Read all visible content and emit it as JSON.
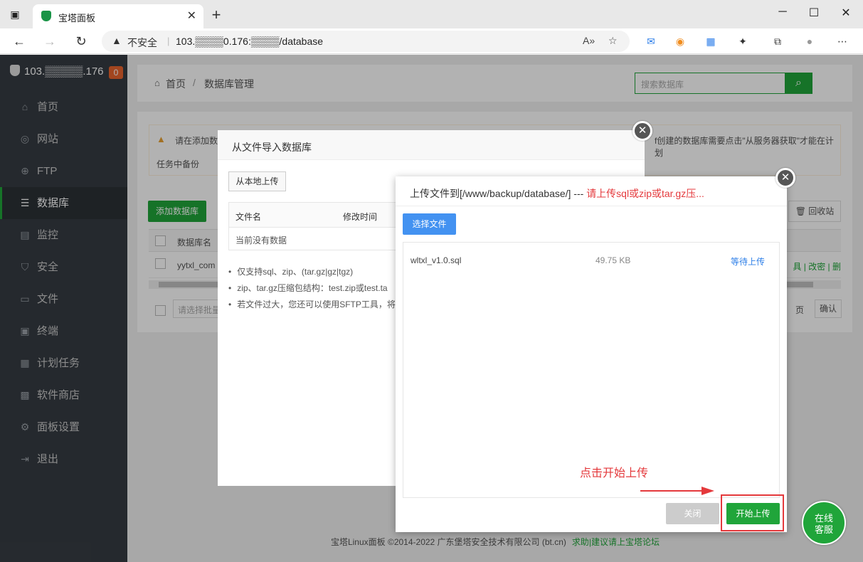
{
  "browser": {
    "tab_title": "宝塔面板",
    "insecure_label": "不安全",
    "url": "103.▒▒▒▒0.176:▒▒▒▒/database"
  },
  "sidebar": {
    "server": "103.▒▒▒▒▒.176",
    "badge": "0",
    "items": [
      {
        "label": "首页",
        "icon": "home-icon"
      },
      {
        "label": "网站",
        "icon": "globe-icon"
      },
      {
        "label": "FTP",
        "icon": "ftp-icon"
      },
      {
        "label": "数据库",
        "icon": "database-icon"
      },
      {
        "label": "监控",
        "icon": "monitor-icon"
      },
      {
        "label": "安全",
        "icon": "shield-icon"
      },
      {
        "label": "文件",
        "icon": "folder-icon"
      },
      {
        "label": "终端",
        "icon": "terminal-icon"
      },
      {
        "label": "计划任务",
        "icon": "calendar-icon"
      },
      {
        "label": "软件商店",
        "icon": "apps-icon"
      },
      {
        "label": "面板设置",
        "icon": "gear-icon"
      },
      {
        "label": "退出",
        "icon": "logout-icon"
      }
    ],
    "active_index": 3
  },
  "header": {
    "crumb_home": "首页",
    "crumb_sep": "/",
    "crumb_current": "数据库管理",
    "search_placeholder": "搜索数据库"
  },
  "panel": {
    "notice_left": "请在添加数",
    "notice_right": "f创建的数据库需要点击\"从服务器获取\"才能在计划",
    "notice_line2": "任务中备份",
    "add_button": "添加数据库",
    "recycle_button": "回收站",
    "col_name": "数据库名",
    "row_name": "yytxl_com",
    "row_ops": "具 | 改密 | 删",
    "batch_placeholder": "请选择批量",
    "page_label": "页",
    "confirm_label": "确认"
  },
  "footer": {
    "copyright": "宝塔Linux面板 ©2014-2022 广东堡塔安全技术有限公司 (bt.cn)",
    "link": "求助|建议请上宝塔论坛"
  },
  "modal_import": {
    "title": "从文件导入数据库",
    "local_upload": "从本地上传",
    "col_filename": "文件名",
    "col_mtime": "修改时间",
    "empty": "当前没有数据",
    "notes": [
      "仅支持sql、zip、(tar.gz|gz|tgz)",
      "zip、tar.gz压缩包结构：test.zip或test.ta",
      "若文件过大，您还可以使用SFTP工具，将"
    ]
  },
  "modal_upload": {
    "title": "上传文件到[/www/backup/database/] --- ",
    "title_warn": "请上传sql或zip或tar.gz压...",
    "choose_button": "选择文件",
    "file": {
      "name": "wltxl_v1.0.sql",
      "size": "49.75 KB",
      "status": "等待上传"
    },
    "hint": "点击开始上传",
    "close_button": "关闭",
    "start_button": "开始上传"
  },
  "support": {
    "line1": "在线",
    "line2": "客服"
  },
  "colors": {
    "accent": "#20a53a",
    "sidebar": "#363c43",
    "warn_red": "#e4393c",
    "blue": "#4392f1"
  }
}
